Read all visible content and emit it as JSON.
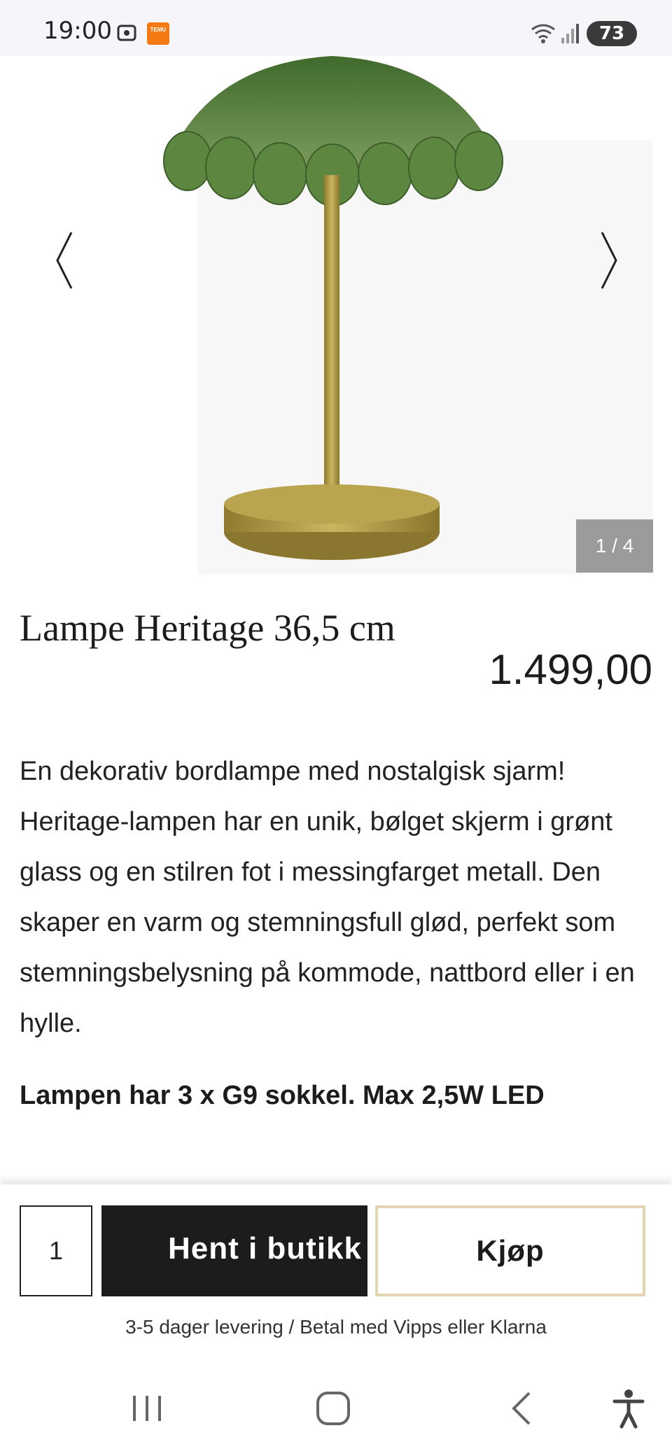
{
  "status_bar": {
    "time": "19:00",
    "battery": "73",
    "temu_label": "TEMU"
  },
  "carousel": {
    "counter": "1 / 4",
    "prev_icon": "chevron-left-icon",
    "next_icon": "chevron-right-icon"
  },
  "product": {
    "title": "Lampe Heritage 36,5 cm",
    "price": "1.499,00",
    "description": "En dekorativ bordlampe med nostalgisk sjarm! Heritage-lampen har en unik, bølget skjerm i grønt glass og en stilren fot i messingfarget metall. Den skaper en varm og stemningsfull glød, perfekt som stemningsbelysning på kommode, nattbord eller i en hylle.",
    "spec": "Lampen har 3 x G9 sokkel. Max 2,5W LED"
  },
  "buy_bar": {
    "quantity": "1",
    "store_button": "Hent i butikk",
    "buy_button": "Kjøp",
    "delivery_text": "3-5 dager levering / Betal med Vipps eller Klarna"
  },
  "colors": {
    "accent_border": "#e3d5b2",
    "dark_button": "#1c1c1c",
    "counter_bg": "#9b9b9b"
  }
}
